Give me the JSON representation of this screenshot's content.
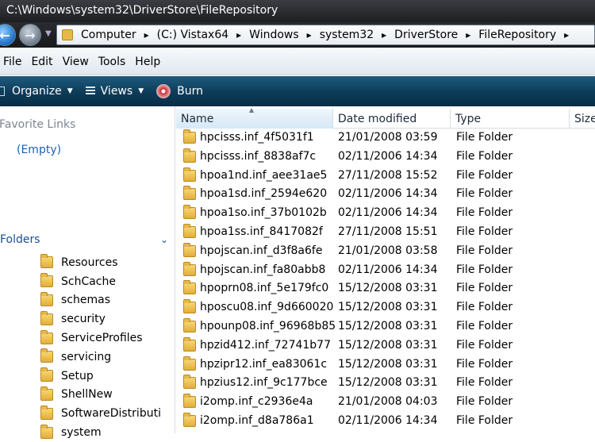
{
  "window": {
    "title": "C:\\Windows\\system32\\DriverStore\\FileRepository"
  },
  "address_bar": {
    "breadcrumbs": [
      "Computer",
      "(C:) Vistax64",
      "Windows",
      "system32",
      "DriverStore",
      "FileRepository"
    ]
  },
  "menu": [
    "File",
    "Edit",
    "View",
    "Tools",
    "Help"
  ],
  "toolbar": {
    "organize": "Organize",
    "views": "Views",
    "burn": "Burn"
  },
  "nav_pane": {
    "favorite_links_title": "Favorite Links",
    "favorite_links_empty": "(Empty)",
    "folders_title": "Folders",
    "folder_tree": [
      "Resources",
      "SchCache",
      "schemas",
      "security",
      "ServiceProfiles",
      "servicing",
      "Setup",
      "ShellNew",
      "SoftwareDistributi",
      "system"
    ]
  },
  "file_list": {
    "columns": {
      "name": "Name",
      "date": "Date modified",
      "type": "Type",
      "size": "Size"
    },
    "rows": [
      {
        "name": "hpcisss.inf_4f5031f1",
        "date": "21/01/2008 03:59",
        "type": "File Folder"
      },
      {
        "name": "hpcisss.inf_8838af7c",
        "date": "02/11/2006 14:34",
        "type": "File Folder"
      },
      {
        "name": "hpoa1nd.inf_aee31ae5",
        "date": "27/11/2008 15:52",
        "type": "File Folder"
      },
      {
        "name": "hpoa1sd.inf_2594e620",
        "date": "02/11/2006 14:34",
        "type": "File Folder"
      },
      {
        "name": "hpoa1so.inf_37b0102b",
        "date": "02/11/2006 14:34",
        "type": "File Folder"
      },
      {
        "name": "hpoa1ss.inf_8417082f",
        "date": "27/11/2008 15:51",
        "type": "File Folder"
      },
      {
        "name": "hpojscan.inf_d3f8a6fe",
        "date": "21/01/2008 03:58",
        "type": "File Folder"
      },
      {
        "name": "hpojscan.inf_fa80abb8",
        "date": "02/11/2006 14:34",
        "type": "File Folder"
      },
      {
        "name": "hpoprn08.inf_5e179fc0",
        "date": "15/12/2008 03:31",
        "type": "File Folder"
      },
      {
        "name": "hposcu08.inf_9d660020",
        "date": "15/12/2008 03:31",
        "type": "File Folder"
      },
      {
        "name": "hpounp08.inf_96968b85",
        "date": "15/12/2008 03:31",
        "type": "File Folder"
      },
      {
        "name": "hpzid412.inf_72741b77",
        "date": "15/12/2008 03:31",
        "type": "File Folder"
      },
      {
        "name": "hpzipr12.inf_ea83061c",
        "date": "15/12/2008 03:31",
        "type": "File Folder"
      },
      {
        "name": "hpzius12.inf_9c177bce",
        "date": "15/12/2008 03:31",
        "type": "File Folder"
      },
      {
        "name": "i2omp.inf_c2936e4a",
        "date": "21/01/2008 04:03",
        "type": "File Folder"
      },
      {
        "name": "i2omp.inf_d8a786a1",
        "date": "02/11/2006 14:34",
        "type": "File Folder"
      }
    ]
  }
}
